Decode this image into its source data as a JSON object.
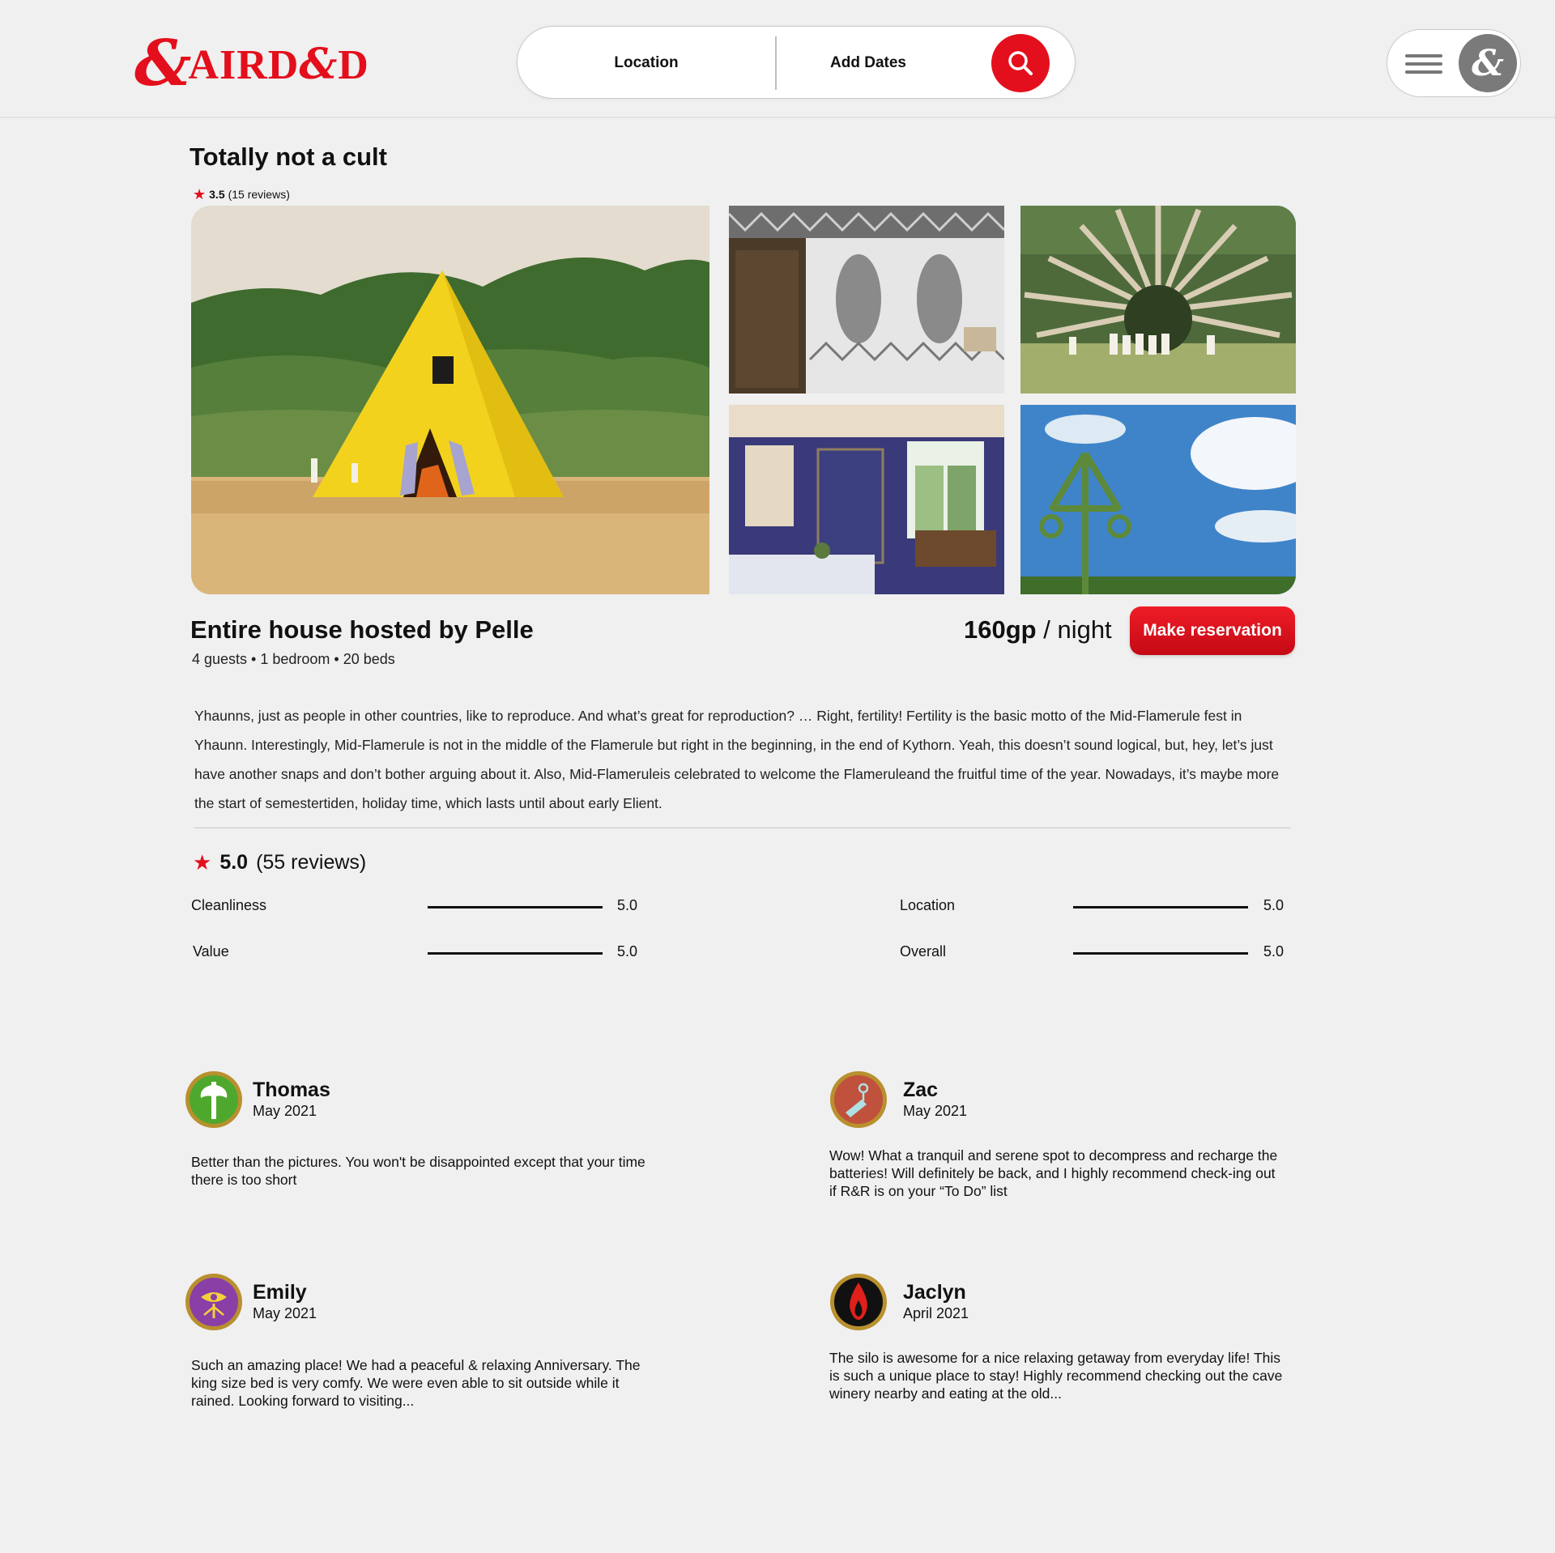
{
  "header": {
    "logo_text": "AIRD&D",
    "logo_prefix": "AIRD",
    "logo_amp": "&",
    "logo_suffix": "D",
    "search": {
      "location_label": "Location",
      "dates_label": "Add Dates"
    },
    "icons": {
      "search": "search-icon",
      "menu": "hamburger-menu-icon",
      "avatar": "ampersand-avatar-icon"
    },
    "accent_color": "#e40f1c"
  },
  "listing": {
    "title": "Totally not a cult",
    "rating": "3.5",
    "reviews_count_text": "(15 reviews)",
    "host_title": "Entire house hosted by Pelle",
    "details": "4 guests • 1 bedroom • 20 beds",
    "price": "160gp",
    "price_unit": " / night",
    "reserve_label": "Make reservation",
    "description": "Yhaunns, just as people in other countries, like to reproduce. And what’s great for reproduction? … Right, fertility! Fertility is the basic motto of the Mid-Flamerule fest in Yhaunn. Interestingly, Mid-Flamerule is not in the middle of the Flamerule but right in the beginning, in the end of Kythorn. Yeah, this doesn’t sound logical, but, hey, let’s just have another snaps and don’t bother arguing about it. Also, Mid-Flameruleis celebrated to welcome the Flameruleand the fruitful time of the year. Nowadays, it’s maybe more the start of semestertiden, holiday time, which lasts until about early Elient."
  },
  "ratings": {
    "overall": "5.0",
    "count_text": "(55 reviews)",
    "categories": [
      {
        "label": "Cleanliness",
        "value": "5.0",
        "fraction": 1.0
      },
      {
        "label": "Location",
        "value": "5.0",
        "fraction": 1.0
      },
      {
        "label": "Value",
        "value": "5.0",
        "fraction": 1.0
      },
      {
        "label": "Overall",
        "value": "5.0",
        "fraction": 1.0
      }
    ]
  },
  "reviews": [
    {
      "name": "Thomas",
      "date": "May 2021",
      "text": "Better than the pictures. You won't be disappointed except that your time there is too short",
      "avatar_icon": "green-axe-icon"
    },
    {
      "name": "Zac",
      "date": "May 2021",
      "text": "Wow! What a tranquil and serene spot to decompress and recharge the batteries! Will definitely be back, and I highly recommend check-ing out if R&R is on your “To Do” list",
      "avatar_icon": "red-hand-icon"
    },
    {
      "name": "Emily",
      "date": "May 2021",
      "text": "Such an amazing place! We had a peaceful & relaxing Anniversary. The king size bed is very comfy. We were even able to sit outside while it rained. Looking forward to visiting...",
      "avatar_icon": "purple-eye-icon"
    },
    {
      "name": "Jaclyn",
      "date": "April 2021",
      "text": "The silo is awesome for a nice relaxing getaway from everyday life! This is such a unique place to stay! Highly recommend checking out the cave winery nearby and eating at the old...",
      "avatar_icon": "flame-icon"
    }
  ]
}
